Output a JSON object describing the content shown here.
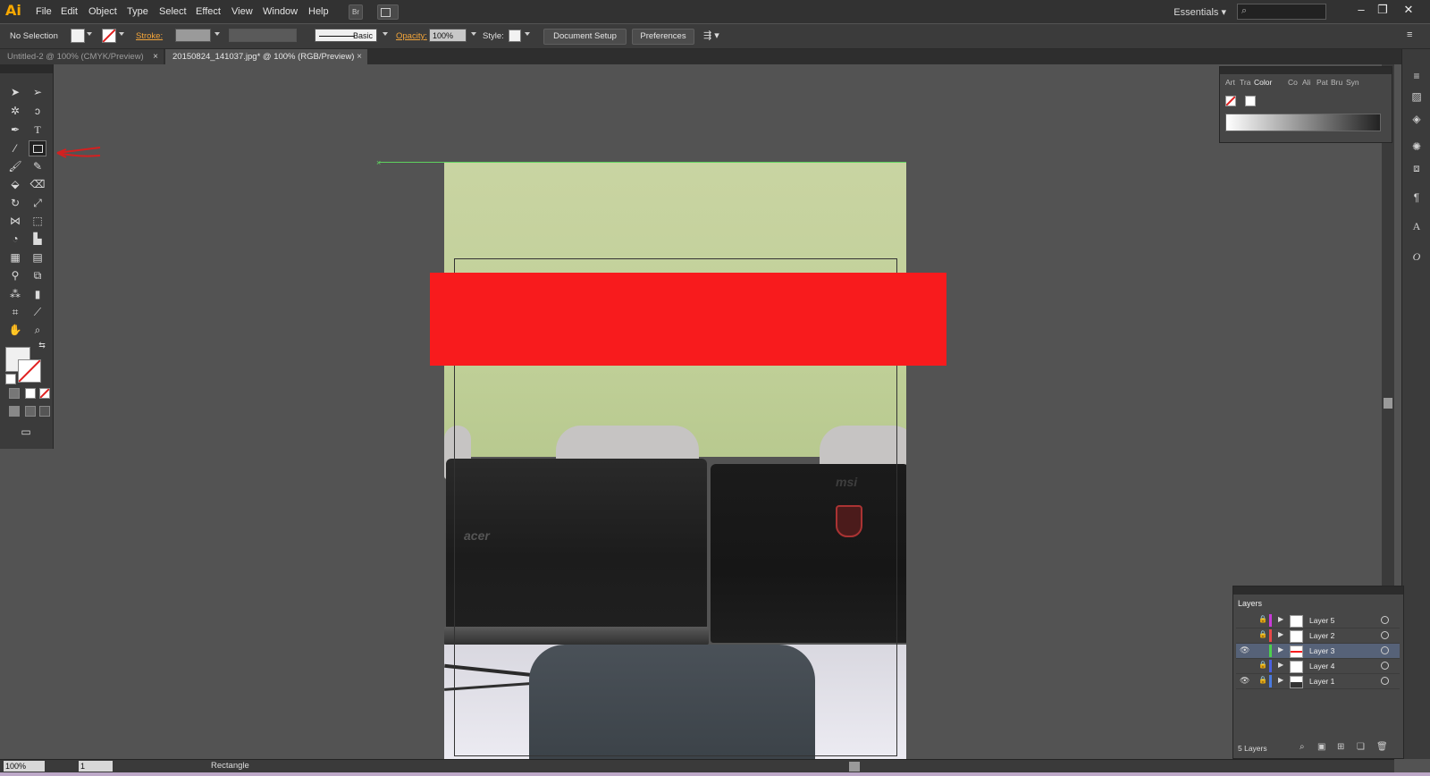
{
  "app": {
    "logo": "Ai"
  },
  "menu": [
    "File",
    "Edit",
    "Object",
    "Type",
    "Select",
    "Effect",
    "View",
    "Window",
    "Help"
  ],
  "menubar": {
    "bridge_label": "Br",
    "workspace": "Essentials",
    "search_placeholder": ""
  },
  "control": {
    "selection": "No Selection",
    "stroke_label": "Stroke:",
    "brush_label": "Basic",
    "opacity_label": "Opacity:",
    "opacity_value": "100%",
    "style_label": "Style:",
    "doc_setup": "Document Setup",
    "preferences": "Preferences"
  },
  "tabs": [
    {
      "label": "Untitled-2 @ 100% (CMYK/Preview)",
      "active": false
    },
    {
      "label": "20150824_141037.jpg* @ 100% (RGB/Preview)",
      "active": true
    }
  ],
  "artwork": {
    "acer_logo": "acer",
    "msi_logo": "msi",
    "shape_color": "#f81b1d"
  },
  "status": {
    "zoom": "100%",
    "page": "1",
    "tool_name": "Rectangle"
  },
  "color_panel": {
    "tabs": [
      "Art",
      "Tra",
      "Color",
      "Co",
      "Ali",
      "Pat",
      "Bru",
      "Syn"
    ],
    "active_tab": "Color"
  },
  "layers_panel": {
    "title": "Layers",
    "count_label": "5 Layers",
    "layers": [
      {
        "name": "Layer 5",
        "color": "#c83ad8",
        "visible": false,
        "locked": true,
        "selected": false
      },
      {
        "name": "Layer 2",
        "color": "#e84848",
        "visible": false,
        "locked": true,
        "selected": false
      },
      {
        "name": "Layer 3",
        "color": "#4cd04c",
        "visible": true,
        "locked": false,
        "selected": true
      },
      {
        "name": "Layer 4",
        "color": "#4a5fe0",
        "visible": false,
        "locked": true,
        "selected": false
      },
      {
        "name": "Layer 1",
        "color": "#4a7ae0",
        "visible": true,
        "locked": true,
        "selected": false
      }
    ]
  }
}
